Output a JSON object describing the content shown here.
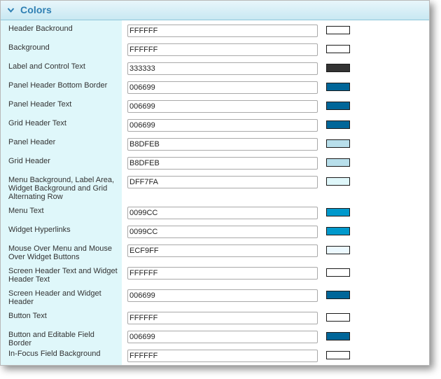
{
  "panel": {
    "title": "Colors"
  },
  "icons": {
    "collapse": "chevron-down-icon"
  },
  "colors": {
    "header_text": "#2e7fb3",
    "label_column_bg": "#DFF7FA"
  },
  "rows": [
    {
      "label": "Header Backround",
      "value": "FFFFFF",
      "swatch": "#FFFFFF"
    },
    {
      "label": "Background",
      "value": "FFFFFF",
      "swatch": "#FFFFFF"
    },
    {
      "label": "Label and Control Text",
      "value": "333333",
      "swatch": "#333333"
    },
    {
      "label": "Panel Header Bottom Border",
      "value": "006699",
      "swatch": "#006699"
    },
    {
      "label": "Panel Header Text",
      "value": "006699",
      "swatch": "#006699"
    },
    {
      "label": "Grid Header Text",
      "value": "006699",
      "swatch": "#006699"
    },
    {
      "label": "Panel Header",
      "value": "B8DFEB",
      "swatch": "#B8DFEB"
    },
    {
      "label": "Grid Header",
      "value": "B8DFEB",
      "swatch": "#B8DFEB"
    },
    {
      "label": "Menu Background, Label Area, Widget Background and Grid Alternating Row",
      "value": "DFF7FA",
      "swatch": "#DFF7FA"
    },
    {
      "label": "Menu Text",
      "value": "0099CC",
      "swatch": "#0099CC"
    },
    {
      "label": "Widget Hyperlinks",
      "value": "0099CC",
      "swatch": "#0099CC"
    },
    {
      "label": "Mouse Over Menu and Mouse Over Widget Buttons",
      "value": "ECF9FF",
      "swatch": "#ECF9FF"
    },
    {
      "label": "Screen Header Text and Widget Header Text",
      "value": "FFFFFF",
      "swatch": "#FFFFFF"
    },
    {
      "label": "Screen Header and Widget Header",
      "value": "006699",
      "swatch": "#006699"
    },
    {
      "label": "Button Text",
      "value": "FFFFFF",
      "swatch": "#FFFFFF"
    },
    {
      "label": "Button and Editable Field Border",
      "value": "006699",
      "swatch": "#006699"
    },
    {
      "label": "In-Focus Field Background",
      "value": "FFFFFF",
      "swatch": "#FFFFFF"
    }
  ]
}
